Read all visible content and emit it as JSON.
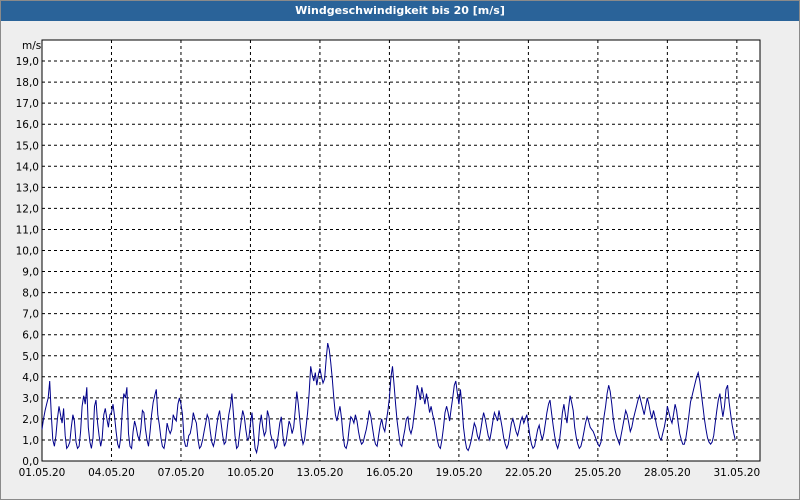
{
  "window": {
    "title": "Windgeschwindigkeit bis 20 [m/s]"
  },
  "chart_data": {
    "type": "line",
    "title": "Windgeschwindigkeit bis 20 [m/s]",
    "ylabel": "m/s",
    "ylim": [
      0,
      20
    ],
    "xlim": [
      "2020-05-01",
      "2020-06-01"
    ],
    "grid": true,
    "yticks": [
      "0,0",
      "1,0",
      "2,0",
      "3,0",
      "4,0",
      "5,0",
      "6,0",
      "7,0",
      "8,0",
      "9,0",
      "10,0",
      "11,0",
      "12,0",
      "13,0",
      "14,0",
      "15,0",
      "16,0",
      "17,0",
      "18,0",
      "19,0"
    ],
    "xticks": [
      "01.05.20",
      "04.05.20",
      "07.05.20",
      "10.05.20",
      "13.05.20",
      "16.05.20",
      "19.05.20",
      "22.05.20",
      "25.05.20",
      "28.05.20",
      "31.05.20"
    ],
    "series": [
      {
        "color": "#00008b",
        "x_dates": [
          "2020-05-01",
          "2020-05-02",
          "2020-05-03",
          "2020-05-04",
          "2020-05-05",
          "2020-05-06",
          "2020-05-07",
          "2020-05-08",
          "2020-05-09",
          "2020-05-10",
          "2020-05-11",
          "2020-05-12",
          "2020-05-13",
          "2020-05-14",
          "2020-05-15",
          "2020-05-16",
          "2020-05-17",
          "2020-05-18",
          "2020-05-19",
          "2020-05-20",
          "2020-05-21",
          "2020-05-22",
          "2020-05-23",
          "2020-05-24",
          "2020-05-25",
          "2020-05-26",
          "2020-05-27",
          "2020-05-28",
          "2020-05-29",
          "2020-05-30",
          "2020-05-31",
          "2020-06-01"
        ],
        "values": [
          [
            1.5,
            2.0,
            2.4,
            2.7,
            3.0,
            3.8,
            2.2,
            1.0,
            0.7,
            1.2,
            2.0,
            2.6,
            2.2,
            1.8,
            2.5
          ],
          [
            1.2,
            0.6,
            0.7,
            0.9,
            1.6,
            2.2,
            1.9,
            0.9,
            0.6,
            0.7,
            1.4,
            2.6,
            3.1,
            2.7,
            3.5
          ],
          [
            1.6,
            0.9,
            0.6,
            1.1,
            2.6,
            2.9,
            1.8,
            1.2,
            0.7,
            1.1,
            2.2,
            2.5,
            2.0,
            1.6,
            2.2
          ],
          [
            2.3,
            2.7,
            2.1,
            1.4,
            0.8,
            0.6,
            1.1,
            2.4,
            3.2,
            3.0,
            3.5,
            1.3,
            0.7,
            0.6,
            1.4
          ],
          [
            1.9,
            1.6,
            1.2,
            1.0,
            1.5,
            2.4,
            2.3,
            1.5,
            1.0,
            0.7,
            1.4,
            2.2,
            2.8,
            3.1,
            3.4
          ],
          [
            2.2,
            1.7,
            1.1,
            0.7,
            0.6,
            1.0,
            1.8,
            1.5,
            1.3,
            1.5,
            2.2,
            2.0,
            1.9,
            2.7,
            3.0
          ],
          [
            2.7,
            2.2,
            1.0,
            0.7,
            0.7,
            1.2,
            1.3,
            1.7,
            2.3,
            2.0,
            1.8,
            1.0,
            0.6,
            0.7,
            1.0
          ],
          [
            1.4,
            1.8,
            2.2,
            2.0,
            1.4,
            0.9,
            0.7,
            1.0,
            1.6,
            2.1,
            2.4,
            1.8,
            1.2,
            0.8,
            0.9
          ],
          [
            1.6,
            2.2,
            2.6,
            3.2,
            2.2,
            1.2,
            0.6,
            0.7,
            1.3,
            1.9,
            2.4,
            2.1,
            1.5,
            1.0,
            1.1
          ],
          [
            1.8,
            2.3,
            1.4,
            0.6,
            0.4,
            0.8,
            1.7,
            2.2,
            1.6,
            1.2,
            1.4,
            2.4,
            2.1,
            1.3,
            1.0
          ],
          [
            1.0,
            0.6,
            0.7,
            1.2,
            1.8,
            2.1,
            1.2,
            0.7,
            0.9,
            1.4,
            1.9,
            1.7,
            1.3,
            1.6,
            2.4
          ],
          [
            3.3,
            2.7,
            1.9,
            1.2,
            0.8,
            1.0,
            1.6,
            2.3,
            3.2,
            4.5,
            4.1,
            3.8,
            4.2,
            3.6,
            4.1
          ],
          [
            4.4,
            4.0,
            3.7,
            3.9,
            4.8,
            5.6,
            5.3,
            4.7,
            3.9,
            3.0,
            2.2,
            1.9,
            2.3,
            2.6,
            2.0
          ],
          [
            1.2,
            0.7,
            0.6,
            0.9,
            1.6,
            2.1,
            2.0,
            1.8,
            2.2,
            1.9,
            1.4,
            1.0,
            0.8,
            0.9,
            1.2
          ],
          [
            1.5,
            1.9,
            2.4,
            2.1,
            1.6,
            1.1,
            0.8,
            0.7,
            1.2,
            1.7,
            2.0,
            1.6,
            1.4,
            1.9,
            2.4
          ],
          [
            3.0,
            4.0,
            4.5,
            3.6,
            2.7,
            1.9,
            1.3,
            0.8,
            0.7,
            1.1,
            1.5,
            2.0,
            2.1,
            1.5,
            1.3
          ],
          [
            1.6,
            2.2,
            2.8,
            3.6,
            3.3,
            2.9,
            3.5,
            3.1,
            2.7,
            3.2,
            2.8,
            2.3,
            2.6,
            2.2,
            1.9
          ],
          [
            1.5,
            1.0,
            0.7,
            0.6,
            1.0,
            1.6,
            2.3,
            2.6,
            2.3,
            1.9,
            2.5,
            3.0,
            3.6,
            3.8,
            3.2
          ],
          [
            2.7,
            3.4,
            2.6,
            1.6,
            1.0,
            0.6,
            0.5,
            0.7,
            1.0,
            1.4,
            1.8,
            1.6,
            1.2,
            1.0,
            1.4
          ],
          [
            1.9,
            2.3,
            2.0,
            1.6,
            1.2,
            1.0,
            1.4,
            1.9,
            2.3,
            2.1,
            1.9,
            2.4,
            2.0,
            1.6,
            1.1
          ],
          [
            0.8,
            0.6,
            0.8,
            1.3,
            1.8,
            2.0,
            1.7,
            1.4,
            1.2,
            1.5,
            1.9,
            2.1,
            1.8,
            2.0,
            2.2
          ],
          [
            1.7,
            1.2,
            0.8,
            0.6,
            0.7,
            1.1,
            1.5,
            1.7,
            1.3,
            1.0,
            1.3,
            1.8,
            2.3,
            2.7,
            2.9
          ],
          [
            2.3,
            1.7,
            1.2,
            0.8,
            0.6,
            0.9,
            1.5,
            2.3,
            2.7,
            2.2,
            1.8,
            2.5,
            3.1,
            2.8,
            2.4
          ],
          [
            1.6,
            1.1,
            0.8,
            0.6,
            0.7,
            1.0,
            1.4,
            1.8,
            2.1,
            1.9,
            1.6,
            1.5,
            1.4,
            1.2,
            1.0
          ],
          [
            0.8,
            0.7,
            0.9,
            1.5,
            2.1,
            2.6,
            3.2,
            3.6,
            3.3,
            2.7,
            2.0,
            1.5,
            1.2,
            1.0,
            0.8
          ],
          [
            1.2,
            1.6,
            2.0,
            2.4,
            2.2,
            1.8,
            1.4,
            1.6,
            2.0,
            2.3,
            2.6,
            2.9,
            3.1,
            2.8,
            2.5
          ],
          [
            2.2,
            2.6,
            3.0,
            2.7,
            2.3,
            2.0,
            2.4,
            2.1,
            1.7,
            1.4,
            1.1,
            1.0,
            1.3,
            1.6,
            2.0
          ],
          [
            2.6,
            2.3,
            2.0,
            1.8,
            2.2,
            2.7,
            2.4,
            1.8,
            1.3,
            1.0,
            0.8,
            0.8,
            1.1,
            1.6,
            2.2
          ],
          [
            2.8,
            3.1,
            3.4,
            3.7,
            4.0,
            4.2,
            3.8,
            3.2,
            2.6,
            2.0,
            1.5,
            1.1,
            0.9,
            0.8,
            0.9
          ],
          [
            1.2,
            1.8,
            2.4,
            2.9,
            3.2,
            2.6,
            2.1,
            2.6,
            3.4,
            3.6,
            2.8,
            2.2,
            1.7,
            1.3,
            1.0
          ]
        ]
      }
    ]
  }
}
